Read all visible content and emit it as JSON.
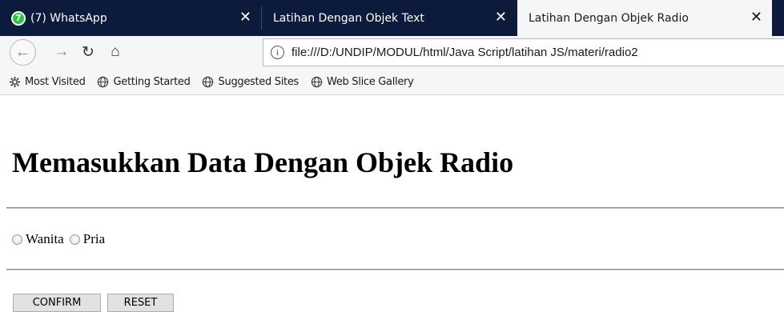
{
  "browser": {
    "tabs": [
      {
        "title": "(7) WhatsApp",
        "badge": "7",
        "close": "✕",
        "active": false
      },
      {
        "title": "Latihan Dengan Objek Text",
        "close": "✕",
        "active": false
      },
      {
        "title": "Latihan Dengan Objek Radio",
        "close": "✕",
        "active": true
      }
    ],
    "nav": {
      "back": "←",
      "forward": "→",
      "reload": "↻",
      "home": "⌂",
      "info": "i"
    },
    "url": "file:///D:/UNDIP/MODUL/html/Java Script/latihan JS/materi/radio2",
    "bookmarks": [
      {
        "label": "Most Visited",
        "icon": "gear-icon"
      },
      {
        "label": "Getting Started",
        "icon": "globe-icon"
      },
      {
        "label": "Suggested Sites",
        "icon": "globe-icon"
      },
      {
        "label": "Web Slice Gallery",
        "icon": "globe-icon"
      }
    ]
  },
  "page": {
    "title": "Memasukkan Data Dengan Objek Radio",
    "radios": [
      {
        "label": "Wanita",
        "checked": false
      },
      {
        "label": "Pria",
        "checked": false
      }
    ],
    "buttons": {
      "confirm": "CONFIRM",
      "reset": "RESET"
    }
  },
  "colors": {
    "tabstrip": "#0c1a3c",
    "toolbar": "#f5f6f7",
    "whatsapp": "#25c53f"
  }
}
